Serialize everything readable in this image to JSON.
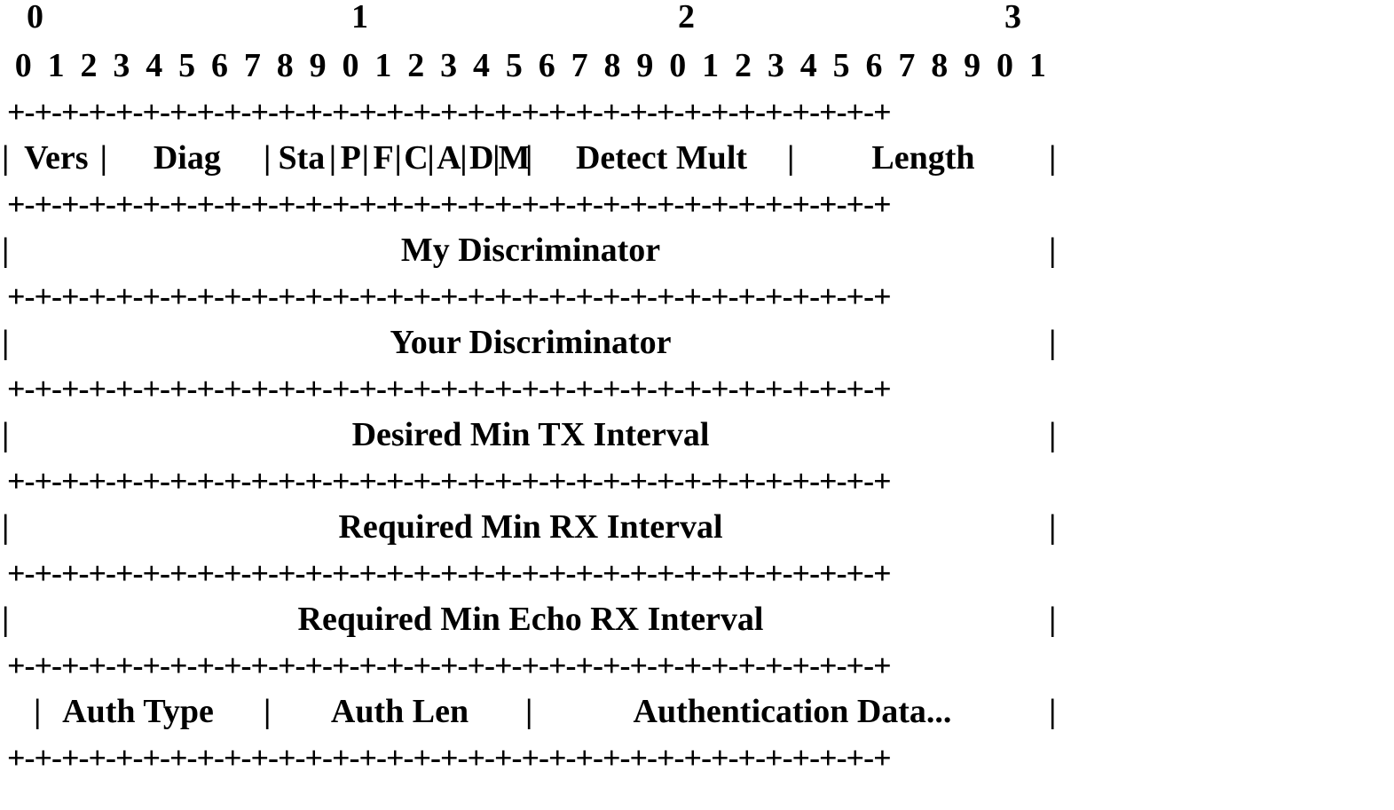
{
  "tens_labels": [
    "0",
    "1",
    "2",
    "3"
  ],
  "bit_labels": [
    "0",
    "1",
    "2",
    "3",
    "4",
    "5",
    "6",
    "7",
    "8",
    "9",
    "0",
    "1",
    "2",
    "3",
    "4",
    "5",
    "6",
    "7",
    "8",
    "9",
    "0",
    "1",
    "2",
    "3",
    "4",
    "5",
    "6",
    "7",
    "8",
    "9",
    "0",
    "1"
  ],
  "separator": "+-+-+-+-+-+-+-+-+-+-+-+-+-+-+-+-+-+-+-+-+-+-+-+-+-+-+-+-+-+-+-+-+",
  "rows": [
    {
      "type": "fields",
      "cells": [
        {
          "label": "Vers",
          "bits": 3
        },
        {
          "label": "Diag",
          "bits": 5
        },
        {
          "label": "Sta",
          "bits": 2
        },
        {
          "label": "P",
          "bits": 1
        },
        {
          "label": "F",
          "bits": 1
        },
        {
          "label": "C",
          "bits": 1
        },
        {
          "label": "A",
          "bits": 1
        },
        {
          "label": "D",
          "bits": 1
        },
        {
          "label": "M",
          "bits": 1
        },
        {
          "label": "Detect Mult",
          "bits": 8
        },
        {
          "label": "Length",
          "bits": 8
        }
      ]
    },
    {
      "type": "single",
      "label": "My Discriminator"
    },
    {
      "type": "single",
      "label": "Your Discriminator"
    },
    {
      "type": "single",
      "label": "Desired Min TX Interval"
    },
    {
      "type": "single",
      "label": "Required Min RX Interval"
    },
    {
      "type": "single",
      "label": "Required Min Echo RX Interval"
    },
    {
      "type": "auth",
      "cells": [
        {
          "label": "Auth Type",
          "bits": 8
        },
        {
          "label": "Auth Len",
          "bits": 8
        },
        {
          "label": "Authentication Data...",
          "bits": 16
        }
      ]
    }
  ]
}
